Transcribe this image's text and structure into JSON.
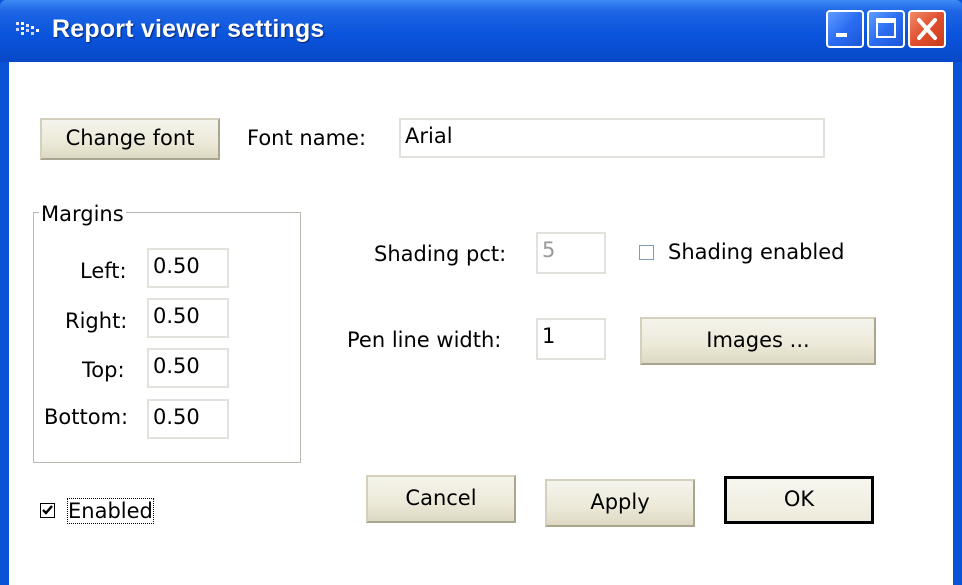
{
  "window": {
    "title": "Report viewer settings",
    "icon": "report-app-icon",
    "controls": [
      "minimize-icon",
      "maximize-icon",
      "close-icon"
    ]
  },
  "font": {
    "change_button": "Change font",
    "name_label": "Font name:",
    "name_value": "Arial"
  },
  "margins": {
    "group_title": "Margins",
    "left_label": "Left:",
    "left_value": "0.50",
    "right_label": "Right:",
    "right_value": "0.50",
    "top_label": "Top:",
    "top_value": "0.50",
    "bottom_label": "Bottom:",
    "bottom_value": "0.50"
  },
  "shading": {
    "pct_label": "Shading pct:",
    "pct_value": "5",
    "enabled_label": "Shading enabled",
    "enabled_checked": false
  },
  "pen": {
    "width_label": "Pen line width:",
    "width_value": "1"
  },
  "images_button": "Images ...",
  "enabled": {
    "label": "Enabled",
    "checked": true
  },
  "footer": {
    "cancel": "Cancel",
    "apply": "Apply",
    "ok": "OK"
  },
  "colors": {
    "titlebar": "#0a55dd",
    "close_button": "#e0502e",
    "button_face": "#ece9d8"
  }
}
